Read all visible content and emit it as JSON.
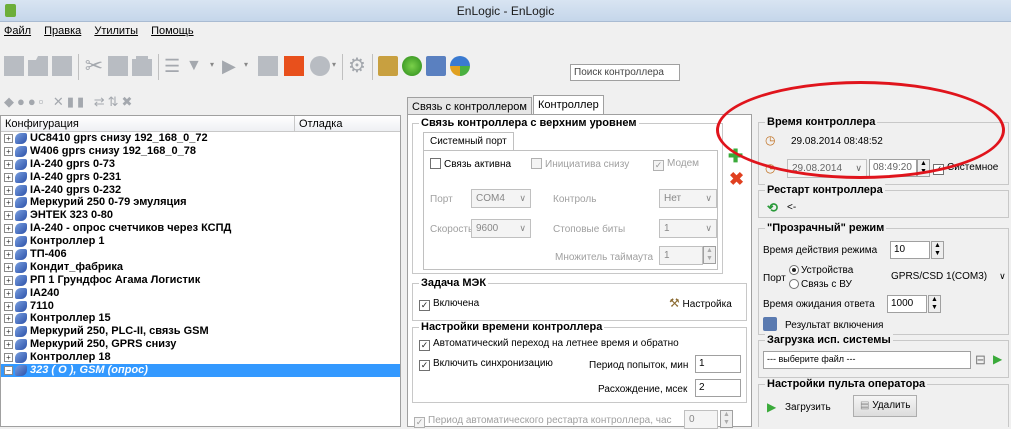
{
  "window": {
    "title": "EnLogic - EnLogic"
  },
  "menu": [
    "Файл",
    "Правка",
    "Утилиты",
    "Помощь"
  ],
  "toolbar": {
    "search_placeholder": "Поиск контроллера"
  },
  "tree": {
    "col_config": "Конфигурация",
    "col_debug": "Отладка",
    "items": [
      "UC8410 gprs снизу 192_168_0_72",
      "W406 gprs снизу 192_168_0_78",
      "IA-240 gprs 0-73",
      "IA-240 gprs 0-231",
      "IA-240 gprs 0-232",
      "Меркурий 250 0-79 эмуляция",
      "ЭНТЕК 323 0-80",
      "IA-240 - опрос счетчиков через КСПД",
      "Контроллер 1",
      "ТП-406",
      "Кондит_фабрика",
      "РП 1 Грундфос Агама Логистик",
      "IA240",
      "7110",
      "Контроллер 15",
      "Меркурий 250, PLC-II, связь GSM",
      "Меркурий 250, GPRS снизу",
      "Контроллер 18",
      "323 ( О ), GSM (опрос)"
    ],
    "selected_index": 18
  },
  "tabs": [
    "Связь с контроллером",
    "Контроллер"
  ],
  "link": {
    "title": "Связь контроллера с верхним уровнем",
    "subtab": "Системный порт",
    "active_label": "Связь активна",
    "initiative_label": "Инициатива снизу",
    "modem_label": "Модем",
    "port_label": "Порт",
    "port_value": "COM4",
    "control_label": "Контроль",
    "control_value": "Нет",
    "speed_label": "Скорость",
    "speed_value": "9600",
    "stopbits_label": "Стоповые биты",
    "stopbits_value": "1",
    "timeout_label": "Множитель таймаута",
    "timeout_value": "1"
  },
  "mek": {
    "title": "Задача МЭК",
    "enabled_label": "Включена",
    "settings_label": "Настройка"
  },
  "timesettings": {
    "title": "Настройки времени контроллера",
    "dst_label": "Автоматический переход на летнее время и обратно",
    "sync_label": "Включить синхронизацию",
    "period_label": "Период попыток, мин",
    "period_value": "1",
    "diff_label": "Расхождение, мсек",
    "diff_value": "2"
  },
  "autorestart": {
    "label": "Период автоматического рестарта контроллера, час",
    "value": "0"
  },
  "ctrltime": {
    "title": "Время контроллера",
    "current": "29.08.2014 08:48:52",
    "date_value": "29.08.2014",
    "time_value": "08:49:20",
    "system_label": "Системное"
  },
  "restart": {
    "title": "Рестарт контроллера",
    "back": "<-"
  },
  "transparent": {
    "title": "\"Прозрачный\" режим",
    "duration_label": "Время действия режима",
    "duration_value": "10",
    "port_label": "Порт",
    "opt_devices": "Устройства",
    "opt_vu": "Связь с ВУ",
    "port_value": "GPRS/CSD 1(COM3)",
    "wait_label": "Время ожидания ответа",
    "wait_value": "1000",
    "result_label": "Результат включения"
  },
  "sysload": {
    "title": "Загрузка исп. системы",
    "placeholder": "--- выберите файл ---"
  },
  "operator": {
    "title": "Настройки пульта оператора",
    "load_label": "Загрузить",
    "delete_label": "Удалить"
  },
  "colors": {
    "highlight": "#e0141c",
    "selection": "#3399ff"
  }
}
